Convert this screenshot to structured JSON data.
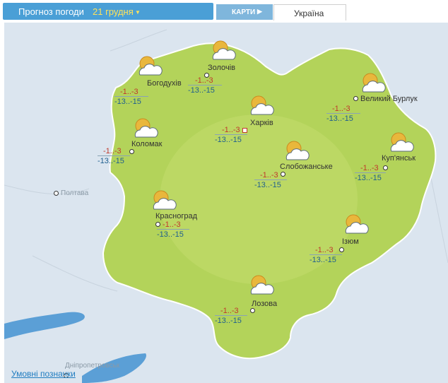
{
  "header": {
    "title": "Прогноз погоди",
    "date": "21 грудня",
    "maps_label": "КАРТИ",
    "region_label": "Україна"
  },
  "map": {
    "colors": {
      "region_fill": "#b3d35a",
      "background": "#dbe5ef",
      "water": "#5b9fd6",
      "day_temp": "#c0392b",
      "night_temp": "#1f5f8f"
    },
    "neighbor_cities": [
      {
        "name": "Полтава"
      },
      {
        "name": "Дніпропетровськ"
      }
    ],
    "cities": [
      {
        "name": "Богодухів",
        "day": "-1..-3",
        "night": "-13..-15",
        "icon": "sun-behind-cloud-icon"
      },
      {
        "name": "Золочів",
        "day": "-1..-3",
        "night": "-13..-15",
        "icon": "sun-behind-cloud-icon"
      },
      {
        "name": "Харків",
        "day": "-1..-3",
        "night": "-13..-15",
        "icon": "sun-behind-cloud-icon"
      },
      {
        "name": "Великий Бурлук",
        "day": "-1..-3",
        "night": "-13..-15",
        "icon": "sun-behind-cloud-icon"
      },
      {
        "name": "Коломак",
        "day": "-1..-3",
        "night": "-13..-15",
        "icon": "sun-behind-cloud-icon"
      },
      {
        "name": "Слобожанське",
        "day": "-1..-3",
        "night": "-13..-15",
        "icon": "sun-behind-cloud-icon"
      },
      {
        "name": "Куп'янськ",
        "day": "-1..-3",
        "night": "-13..-15",
        "icon": "sun-behind-cloud-icon"
      },
      {
        "name": "Красноград",
        "day": "-1..-3",
        "night": "-13..-15",
        "icon": "sun-behind-cloud-icon"
      },
      {
        "name": "Ізюм",
        "day": "-1..-3",
        "night": "-13..-15",
        "icon": "sun-behind-cloud-icon"
      },
      {
        "name": "Лозова",
        "day": "-1..-3",
        "night": "-13..-15",
        "icon": "sun-behind-cloud-icon"
      }
    ]
  },
  "footer": {
    "legend_link": "Умовні позначки"
  }
}
